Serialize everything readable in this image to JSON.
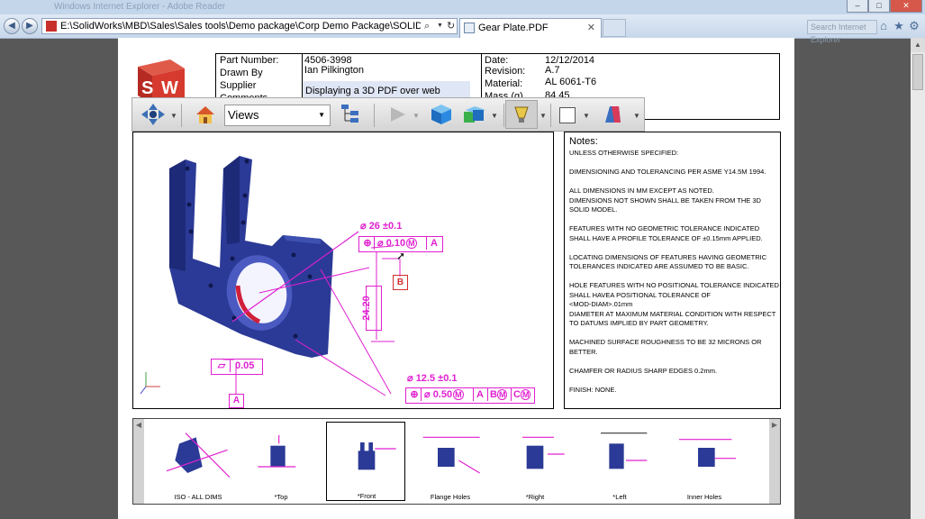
{
  "browser": {
    "window_title": "Windows Internet Explorer - Adobe Reader",
    "url": "E:\\SolidWorks\\MBD\\Sales\\Sales tools\\Demo package\\Corp Demo Package\\SOLIDWORKS MBD",
    "tab_label": "Gear Plate.PDF",
    "search_placeholder": "Search Internet Explorer",
    "min_label": "–",
    "max_label": "□",
    "close_label": "✕"
  },
  "title_block": {
    "part_number_label": "Part Number:",
    "part_number": "4506-3998",
    "drawn_by_label": "Drawn By",
    "drawn_by": "Ian Pilkington",
    "supplier_label": "Supplier",
    "comments_label": "Comments",
    "comments": "Displaying a 3D PDF over web",
    "date_label": "Date:",
    "date": "12/12/2014",
    "revision_label": "Revision:",
    "revision": "A.7",
    "material_label": "Material:",
    "material": "AL 6061-T6",
    "mass_label": "Mass (g)",
    "mass": "84.45"
  },
  "toolbar": {
    "views_label": "Views"
  },
  "annotations": {
    "dim1": "26 ±0.1",
    "fcf1_val": "0.10",
    "fcf1_mod": "M",
    "datum_a": "A",
    "datum_b": "B",
    "dim_vertical": "24.20",
    "flatness": "0.05",
    "dim2": "12.5 ±0.1",
    "fcf2_val": "0.50",
    "fcf2_mod": "M",
    "fcf2_b": "B",
    "fcf2_c": "C",
    "fcf2_a": "A"
  },
  "notes": {
    "title": "Notes:",
    "lines": [
      "UNLESS OTHERWISE SPECIFIED:",
      "",
      "DIMENSIONING AND TOLERANCING PER ASME Y14.5M 1994.",
      "",
      "ALL DIMENSIONS IN MM EXCEPT AS NOTED.",
      "DIMENSIONS NOT SHOWN SHALL BE TAKEN FROM THE 3D",
      "SOLID MODEL.",
      "",
      "FEATURES WITH NO GEOMETRIC TOLERANCE INDICATED",
      "SHALL HAVE A PROFILE TOLERANCE OF ±0.15mm APPLIED.",
      "",
      "LOCATING DIMENSIONS OF FEATURES HAVING GEOMETRIC",
      "TOLERANCES INDICATED ARE ASSUMED TO BE BASIC.",
      "",
      "HOLE FEATURES WITH NO POSITIONAL TOLERANCE INDICATED",
      "SHALL HAVEA POSITIONAL TOLERANCE OF",
      "<MOD-DIAM>.01mm",
      "DIAMETER AT MAXIMUM MATERIAL CONDITION WITH RESPECT",
      "TO DATUMS IMPLIED BY PART GEOMETRY.",
      "",
      "MACHINED SURFACE ROUGHNESS TO BE 32 MICRONS OR",
      "BETTER.",
      "",
      "CHAMFER OR RADIUS SHARP EDGES 0.2mm.",
      "",
      "FINISH:  NONE."
    ]
  },
  "thumbnails": [
    {
      "label": "ISO - ALL DIMS",
      "selected": false
    },
    {
      "label": "*Top",
      "selected": false
    },
    {
      "label": "*Front",
      "selected": true
    },
    {
      "label": "Flange Holes",
      "selected": false
    },
    {
      "label": "*Right",
      "selected": false
    },
    {
      "label": "*Left",
      "selected": false
    },
    {
      "label": "Inner Holes",
      "selected": false
    }
  ],
  "colors": {
    "part_blue": "#2b3a96",
    "annotation_magenta": "#e020d0",
    "datum_red": "#d03030"
  }
}
